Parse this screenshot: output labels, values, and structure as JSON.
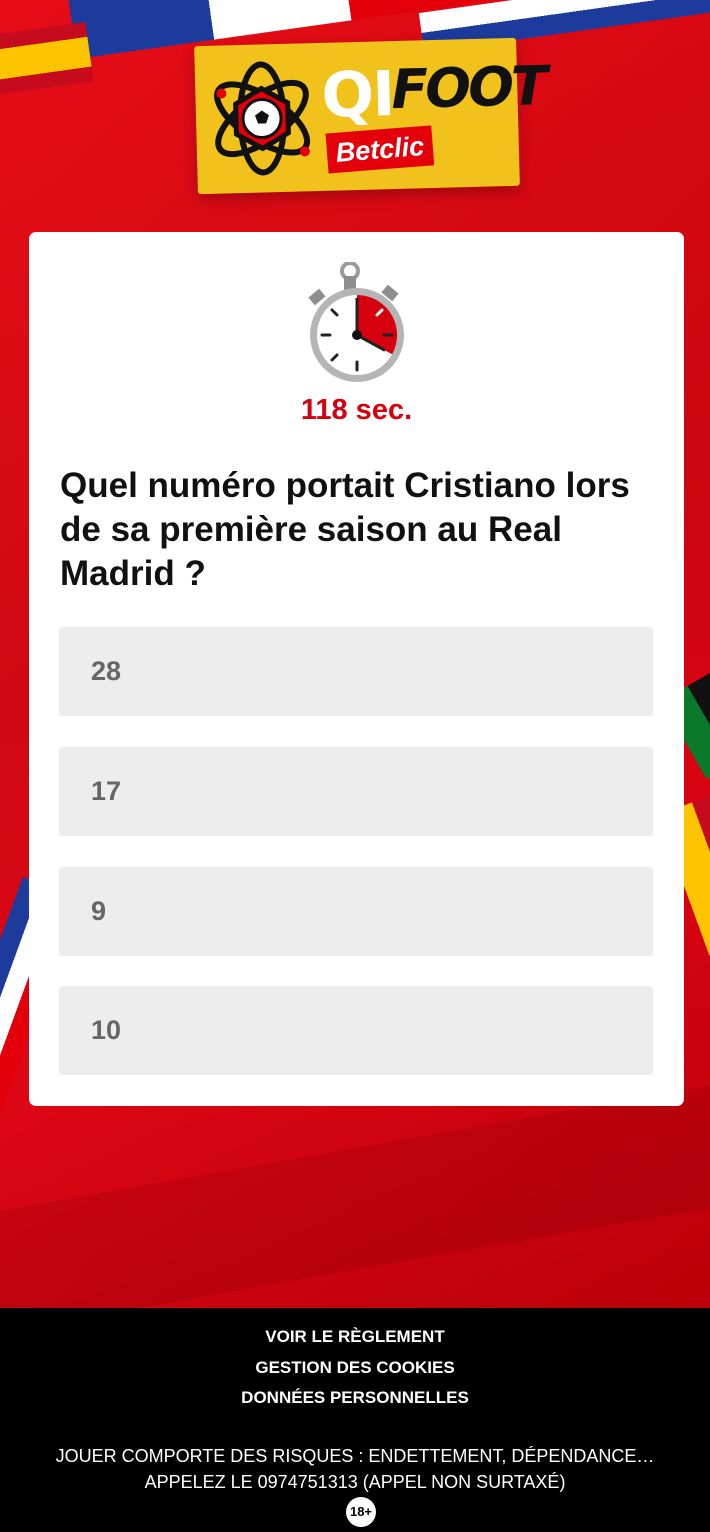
{
  "logo": {
    "qi": "QI",
    "foot": "FOOT",
    "brand": "Betclic"
  },
  "timer": {
    "text": "118 sec.",
    "remaining_fraction": 0.33
  },
  "question": {
    "text": "Quel numéro portait Cristiano lors de sa première saison au Real Madrid ?"
  },
  "answers": [
    {
      "label": "28"
    },
    {
      "label": "17"
    },
    {
      "label": "9"
    },
    {
      "label": "10"
    }
  ],
  "footer": {
    "links": [
      "VOIR LE RÈGLEMENT",
      "GESTION DES COOKIES",
      "DONNÉES PERSONNELLES"
    ],
    "warning_line1": "JOUER COMPORTE DES RISQUES : ENDETTEMENT, DÉPENDANCE…",
    "warning_line2": "APPELEZ LE 0974751313 (APPEL NON SURTAXÉ)",
    "age_badge": "18+"
  },
  "colors": {
    "brand_red": "#e4000b",
    "logo_yellow": "#f1c21b",
    "timer_red": "#d6000f",
    "answer_bg": "#ededed"
  }
}
